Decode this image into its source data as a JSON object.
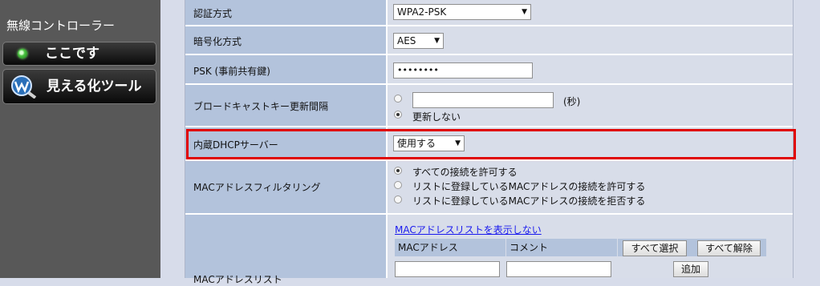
{
  "sidebar": {
    "title": "無線コントローラー",
    "here_button": "ここです",
    "visualize_button": "見える化ツール"
  },
  "settings": {
    "auth_method": {
      "label": "認証方式",
      "value": "WPA2-PSK"
    },
    "encryption": {
      "label": "暗号化方式",
      "value": "AES"
    },
    "psk": {
      "label": "PSK (事前共有鍵)",
      "value": "••••••••"
    },
    "broadcast_key": {
      "label": "ブロードキャストキー更新間隔",
      "seconds_unit": "(秒)",
      "option_no_update": "更新しない",
      "selected": "更新しない"
    },
    "dhcp": {
      "label": "内蔵DHCPサーバー",
      "value": "使用する"
    },
    "mac_filter": {
      "label": "MACアドレスフィルタリング",
      "options": [
        "すべての接続を許可する",
        "リストに登録しているMACアドレスの接続を許可する",
        "リストに登録しているMACアドレスの接続を拒否する"
      ],
      "selected": "すべての接続を許可する"
    },
    "mac_list": {
      "label": "MACアドレスリスト",
      "hide_link": "MACアドレスリストを表示しない",
      "col_mac": "MACアドレス",
      "col_comment": "コメント",
      "select_all": "すべて選択",
      "deselect_all": "すべて解除",
      "add": "追加"
    }
  },
  "colors": {
    "highlight": "#e00000",
    "label_bg": "#b3c3dc",
    "value_bg": "#d8dde9",
    "sidebar_bg": "#585858"
  }
}
